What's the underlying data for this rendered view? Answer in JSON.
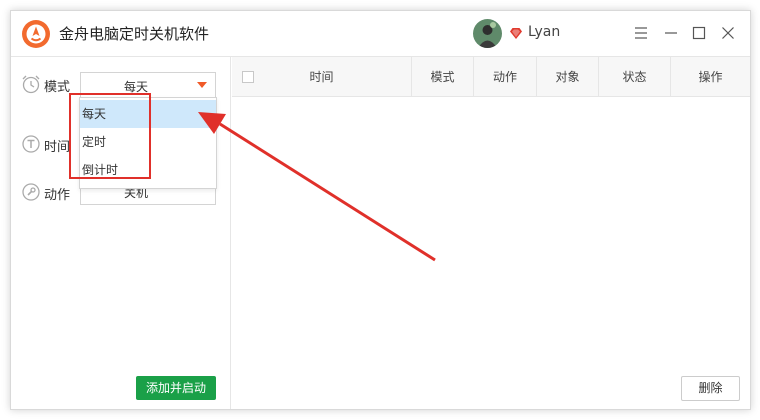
{
  "window": {
    "title": "金舟电脑定时关机软件",
    "username": "Lyan",
    "accent_color": "#f05a28",
    "controls": [
      "menu-icon",
      "minimize-icon",
      "maximize-icon",
      "close-icon"
    ]
  },
  "form": {
    "mode": {
      "label": "模式",
      "value": "每天",
      "options": [
        "每天",
        "定时",
        "倒计时"
      ],
      "selected_index": 0,
      "dropdown_open": true
    },
    "time": {
      "label": "时间"
    },
    "action": {
      "label": "动作",
      "value": "关机"
    },
    "add_button_label": "添加并启动",
    "add_button_color": "#1aa048"
  },
  "table": {
    "columns": [
      "时间",
      "模式",
      "动作",
      "对象",
      "状态",
      "操作"
    ],
    "rows": []
  },
  "footer": {
    "delete_button_label": "删除"
  },
  "annotation": {
    "highlight_color": "#e0302a"
  }
}
